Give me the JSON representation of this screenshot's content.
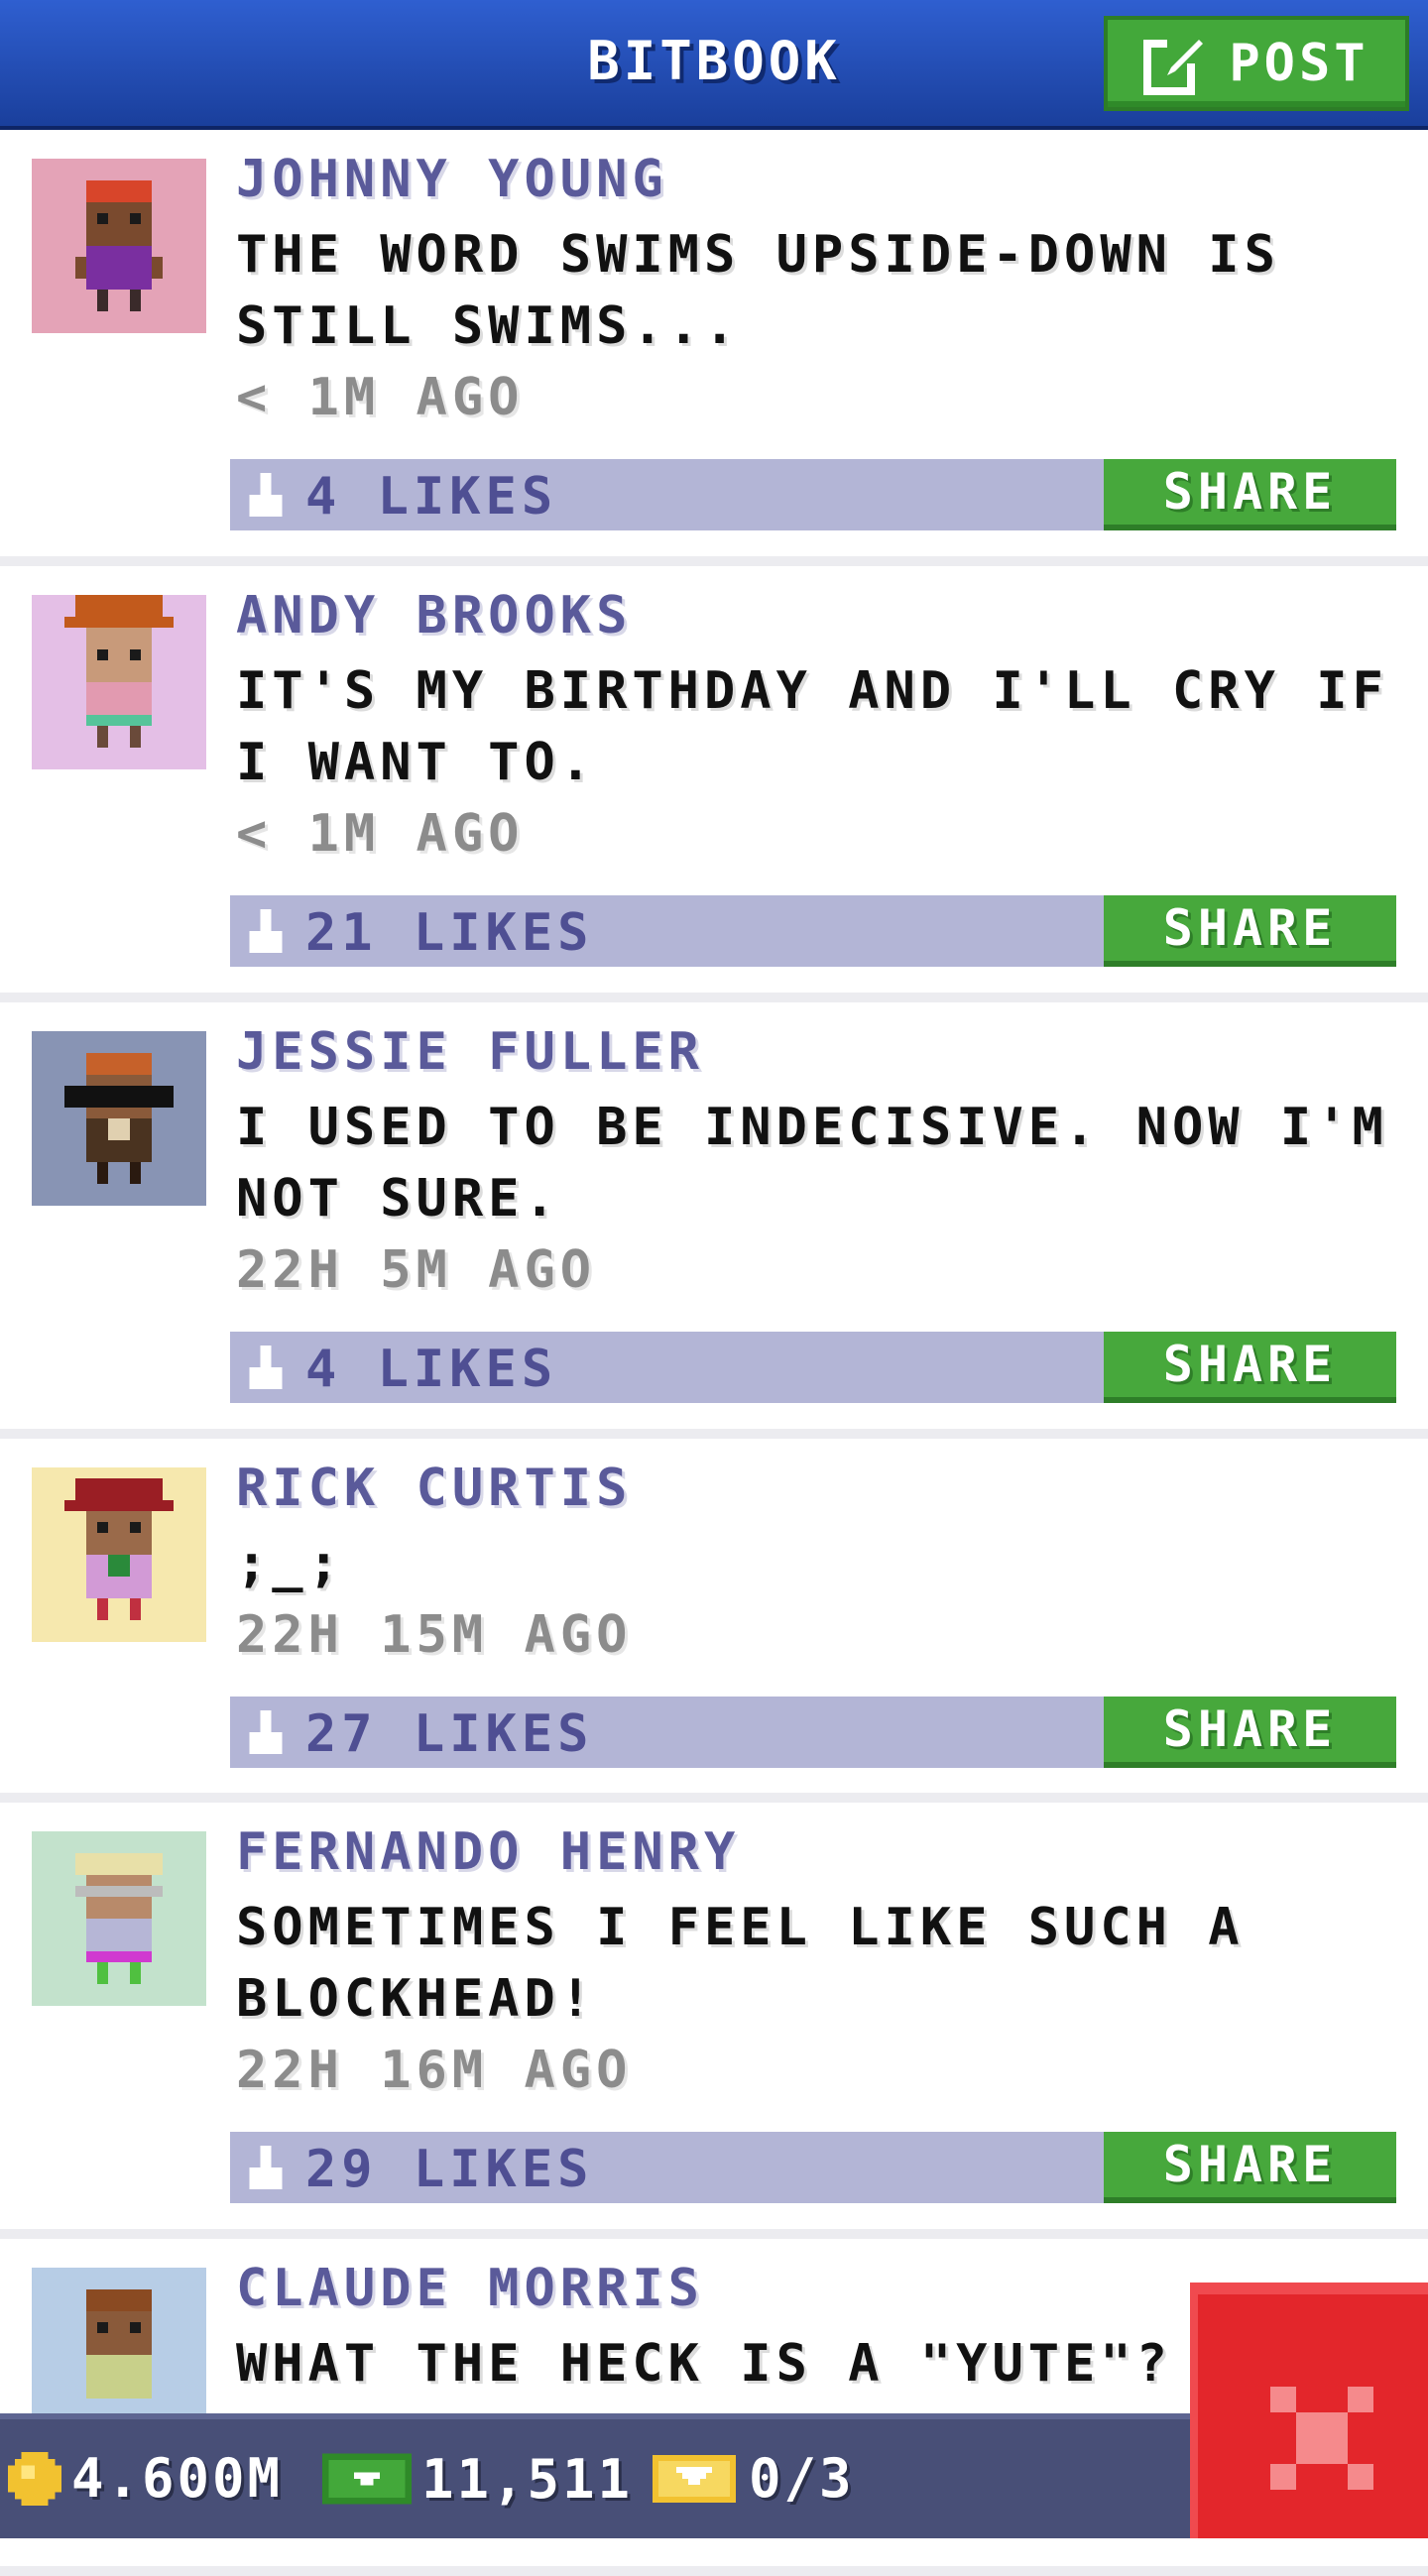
{
  "header": {
    "title": "BITBOOK",
    "post_label": "POST"
  },
  "posts": [
    {
      "author": "JOHNNY YOUNG",
      "message": "THE WORD SWIMS UPSIDE-DOWN IS STILL SWIMS...",
      "time": "< 1M AGO",
      "likes": "4 LIKES",
      "share_label": "SHARE",
      "avatar_bg": "#e4a3b7",
      "hair": "#d8452a",
      "skin": "#7a4a2e",
      "shirt": "#7a2fa0"
    },
    {
      "author": "ANDY BROOKS",
      "message": "IT'S MY BIRTHDAY AND I'LL CRY IF I WANT TO.",
      "time": "< 1M AGO",
      "likes": "21 LIKES",
      "share_label": "SHARE",
      "avatar_bg": "#e4bfe6",
      "hair": "#c25a1c",
      "skin": "#c89a7a",
      "shirt": "#e29ab0"
    },
    {
      "author": "JESSIE FULLER",
      "message": "I USED TO BE INDECISIVE. NOW I'M NOT SURE.",
      "time": "22H 5M AGO",
      "likes": "4 LIKES",
      "share_label": "SHARE",
      "avatar_bg": "#8894b4",
      "hair": "#c6612a",
      "skin": "#8a5a3a",
      "shirt": "#4a3320"
    },
    {
      "author": "RICK CURTIS",
      "message": ";_;",
      "time": "22H 15M AGO",
      "likes": "27 LIKES",
      "share_label": "SHARE",
      "avatar_bg": "#f6e8ae",
      "hair": "#9a1e24",
      "skin": "#9a6a4a",
      "shirt": "#d29ad6"
    },
    {
      "author": "FERNANDO HENRY",
      "message": "SOMETIMES I FEEL LIKE SUCH A BLOCKHEAD!",
      "time": "22H 16M AGO",
      "likes": "29 LIKES",
      "share_label": "SHARE",
      "avatar_bg": "#c3e2cc",
      "hair": "#e8e0a8",
      "skin": "#b88a6a",
      "shirt": "#b6b6d6"
    },
    {
      "author": "CLAUDE MORRIS",
      "message": "WHAT THE HECK IS A \"YUTE\"?",
      "time": "",
      "likes": "",
      "share_label": "",
      "avatar_bg": "#b7cde6",
      "hair": "#8a4a22",
      "skin": "#8a5a3a",
      "shirt": "#c8d08a"
    }
  ],
  "status": {
    "coins": "4.600M",
    "bux": "11,511",
    "tickets": "0/3"
  },
  "colors": {
    "header_blue": "#2f5fd0",
    "share_green": "#47a83c",
    "like_bar": "#b3b5d6",
    "close_red": "#e3262b"
  }
}
